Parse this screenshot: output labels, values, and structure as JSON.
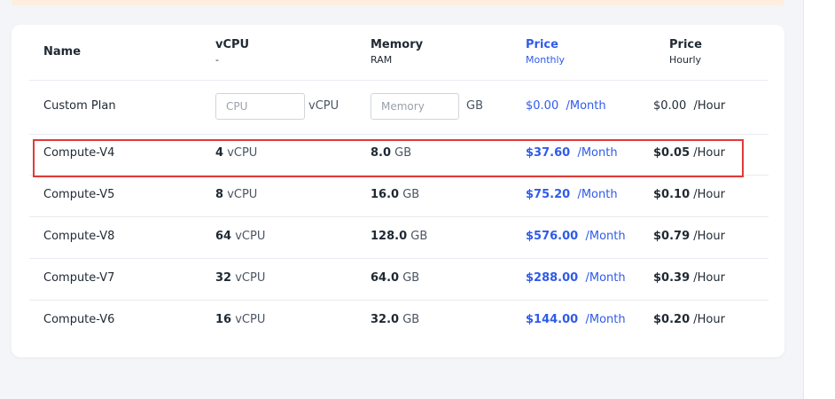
{
  "columns": {
    "name": {
      "title": "Name"
    },
    "vcpu": {
      "title": "vCPU",
      "subtitle": "-"
    },
    "memory": {
      "title": "Memory",
      "subtitle": "RAM"
    },
    "price_monthly": {
      "title": "Price",
      "subtitle": "Monthly"
    },
    "price_hourly": {
      "title": "Price",
      "subtitle": "Hourly"
    }
  },
  "custom_plan": {
    "name": "Custom Plan",
    "cpu_placeholder": "CPU",
    "cpu_unit": "vCPU",
    "memory_placeholder": "Memory",
    "memory_unit": "GB",
    "price_monthly": "$0.00",
    "monthly_unit": "/Month",
    "price_hourly": "$0.00",
    "hourly_unit": "/Hour"
  },
  "plans": [
    {
      "name": "Compute-V4",
      "vcpu": "4",
      "vcpu_unit": "vCPU",
      "memory": "8.0",
      "memory_unit": "GB",
      "price_monthly": "$37.60",
      "monthly_unit": "/Month",
      "price_hourly": "$0.05",
      "hourly_unit": "/Hour"
    },
    {
      "name": "Compute-V5",
      "vcpu": "8",
      "vcpu_unit": "vCPU",
      "memory": "16.0",
      "memory_unit": "GB",
      "price_monthly": "$75.20",
      "monthly_unit": "/Month",
      "price_hourly": "$0.10",
      "hourly_unit": "/Hour"
    },
    {
      "name": "Compute-V8",
      "vcpu": "64",
      "vcpu_unit": "vCPU",
      "memory": "128.0",
      "memory_unit": "GB",
      "price_monthly": "$576.00",
      "monthly_unit": "/Month",
      "price_hourly": "$0.79",
      "hourly_unit": "/Hour"
    },
    {
      "name": "Compute-V7",
      "vcpu": "32",
      "vcpu_unit": "vCPU",
      "memory": "64.0",
      "memory_unit": "GB",
      "price_monthly": "$288.00",
      "monthly_unit": "/Month",
      "price_hourly": "$0.39",
      "hourly_unit": "/Hour"
    },
    {
      "name": "Compute-V6",
      "vcpu": "16",
      "vcpu_unit": "vCPU",
      "memory": "32.0",
      "memory_unit": "GB",
      "price_monthly": "$144.00",
      "monthly_unit": "/Month",
      "price_hourly": "$0.20",
      "hourly_unit": "/Hour"
    }
  ],
  "colors": {
    "accent": "#2f5bea",
    "highlight": "#e03a3a",
    "banner": "#fdeedd"
  }
}
